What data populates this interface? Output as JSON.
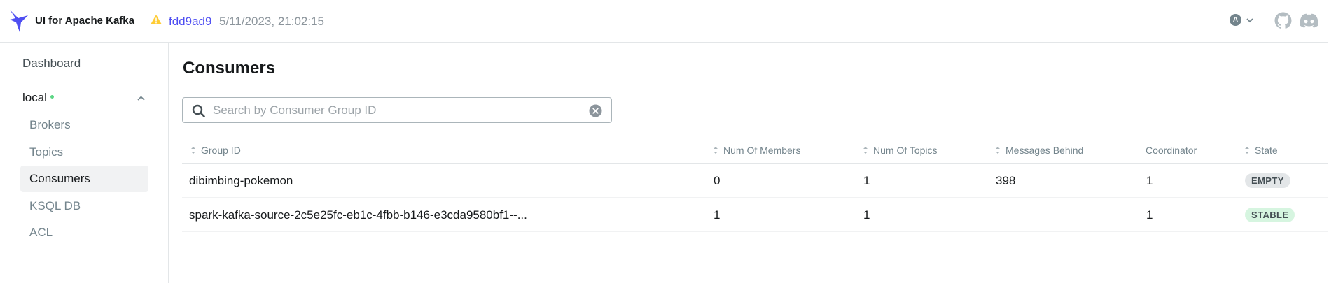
{
  "header": {
    "app_title": "UI for Apache Kafka",
    "commit": "fdd9ad9",
    "build_date": "5/11/2023, 21:02:15",
    "user_initial": "A"
  },
  "sidebar": {
    "dashboard": "Dashboard",
    "cluster": {
      "name": "local",
      "status_color": "#5cd685"
    },
    "items": [
      {
        "label": "Brokers",
        "active": false
      },
      {
        "label": "Topics",
        "active": false
      },
      {
        "label": "Consumers",
        "active": true
      },
      {
        "label": "KSQL DB",
        "active": false
      },
      {
        "label": "ACL",
        "active": false
      }
    ]
  },
  "main": {
    "title": "Consumers",
    "search": {
      "placeholder": "Search by Consumer Group ID",
      "value": ""
    },
    "columns": {
      "group_id": "Group ID",
      "members": "Num Of Members",
      "topics": "Num Of Topics",
      "messages_behind": "Messages Behind",
      "coordinator": "Coordinator",
      "state": "State"
    },
    "rows": [
      {
        "group_id": "dibimbing-pokemon",
        "members": "0",
        "topics": "1",
        "messages_behind": "398",
        "coordinator": "1",
        "state": "EMPTY"
      },
      {
        "group_id": "spark-kafka-source-2c5e25fc-eb1c-4fbb-b146-e3cda9580bf1--...",
        "members": "1",
        "topics": "1",
        "messages_behind": "",
        "coordinator": "1",
        "state": "STABLE"
      }
    ]
  },
  "colors": {
    "accent": "#4f4ff2",
    "warning": "#ffcc33",
    "badge_empty": "#e3e6e8",
    "badge_stable": "#d6f5e0"
  }
}
